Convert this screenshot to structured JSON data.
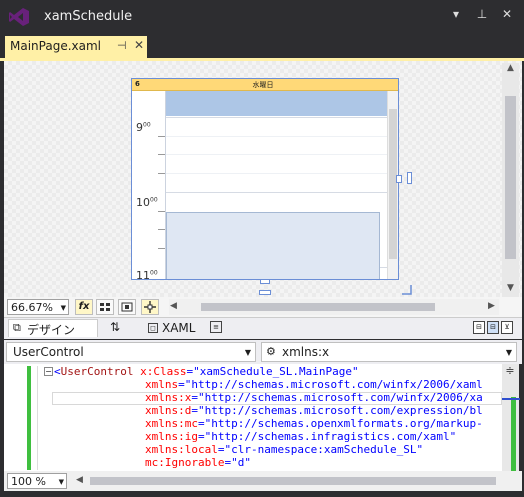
{
  "window": {
    "title": "xamSchedule"
  },
  "titlebar_buttons": {
    "dropdown": "▾",
    "pin": "⊥",
    "close": "✕"
  },
  "tab": {
    "label": "MainPage.xaml",
    "pin_glyph": "⊣",
    "close_glyph": "✕"
  },
  "designer": {
    "day_number": "6",
    "day_name": "水曜日",
    "hours": [
      {
        "label": "9",
        "suffix": "00"
      },
      {
        "label": "10",
        "suffix": "00"
      },
      {
        "label": "11",
        "suffix": "00"
      }
    ]
  },
  "zoom": {
    "value": "66.67%",
    "arrow": "▼",
    "fx_label": "fx"
  },
  "split": {
    "design_label": "デザイン",
    "swap_glyph": "⇅",
    "xaml_label": "XAML",
    "btn_labels": [
      "⊟",
      "⊟",
      "⊻"
    ]
  },
  "selectors": {
    "type_value": "UserControl",
    "member_value": "xmlns:x",
    "arrow": "▼",
    "member_icon": "⚙"
  },
  "code": {
    "lines": [
      {
        "tag": "UserControl",
        "attr": "x:Class",
        "val": "\"xamSchedule_SL.MainPage\""
      },
      {
        "attr": "xmlns",
        "val": "\"http://schemas.microsoft.com/winfx/2006/xaml"
      },
      {
        "attr": "xmlns:x",
        "val": "\"http://schemas.microsoft.com/winfx/2006/xa"
      },
      {
        "attr": "xmlns:d",
        "val": "\"http://schemas.microsoft.com/expression/bl"
      },
      {
        "attr": "xmlns:mc",
        "val": "\"http://schemas.openxmlformats.org/markup-"
      },
      {
        "attr": "xmlns:ig",
        "val": "\"http://schemas.infragistics.com/xaml\""
      },
      {
        "attr": "xmlns:local",
        "val": "\"clr-namespace:xamSchedule_SL\""
      },
      {
        "attr": "mc:Ignorable",
        "val": "\"d\""
      }
    ]
  },
  "code_zoom": {
    "value": "100 %",
    "arrow": "▼"
  },
  "colors": {
    "tab_active": "#fff0a6",
    "chrome": "#2d2d30",
    "allday": "#adc6e6",
    "header": "#ffd978",
    "git_added": "#3fbf3f"
  }
}
